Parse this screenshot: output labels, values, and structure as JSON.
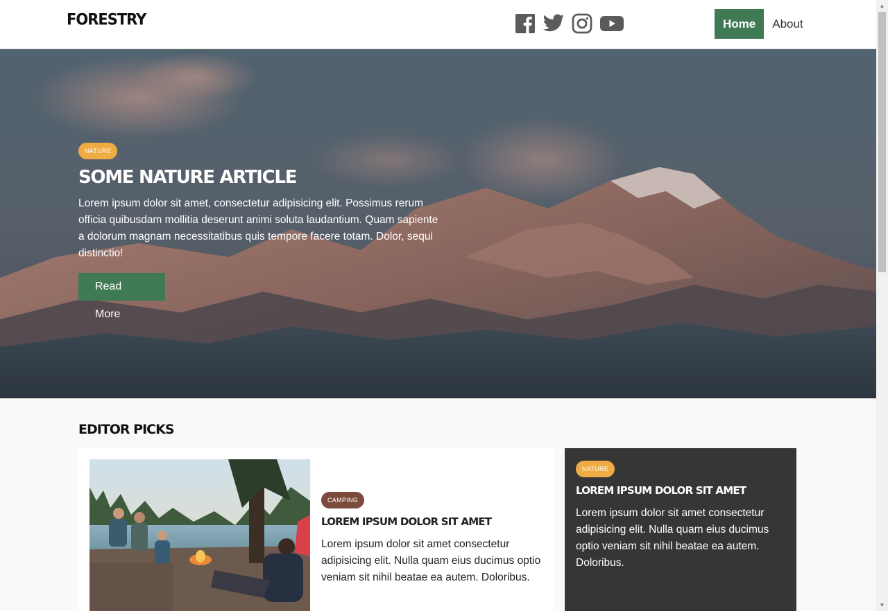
{
  "header": {
    "logo": "FORESTRY",
    "social": [
      "facebook-icon",
      "twitter-icon",
      "instagram-icon",
      "youtube-icon"
    ],
    "nav": [
      {
        "label": "Home",
        "active": true
      },
      {
        "label": "About",
        "active": false
      }
    ]
  },
  "hero": {
    "tag": "NATURE",
    "title": "SOME NATURE ARTICLE",
    "text": "Lorem ipsum dolor sit amet, consectetur adipisicing elit. Possimus rerum officia quibusdam mollitia deserunt animi soluta laudantium. Quam sapiente a dolorum magnam necessitatibus quis tempore facere totam. Dolor, sequi distinctio!",
    "button": "Read More"
  },
  "editor_picks": {
    "heading": "EDITOR PICKS",
    "main_card": {
      "tag": "CAMPING",
      "title": "LOREM IPSUM DOLOR SIT AMET",
      "text": "Lorem ipsum dolor sit amet consectetur adipisicing elit. Nulla quam eius ducimus optio veniam sit nihil beatae ea autem. Doloribus."
    },
    "side_card": {
      "tag": "NATURE",
      "title": "LOREM IPSUM DOLOR SIT AMET",
      "text": "Lorem ipsum dolor sit amet consectetur adipisicing elit. Nulla quam eius ducimus optio veniam sit nihil beatae ea autem. Doloribus."
    }
  },
  "colors": {
    "accent_green": "#3f7a55",
    "tag_nature": "#efac45",
    "tag_camping": "#7b4b3c",
    "dark_card": "#363636"
  }
}
